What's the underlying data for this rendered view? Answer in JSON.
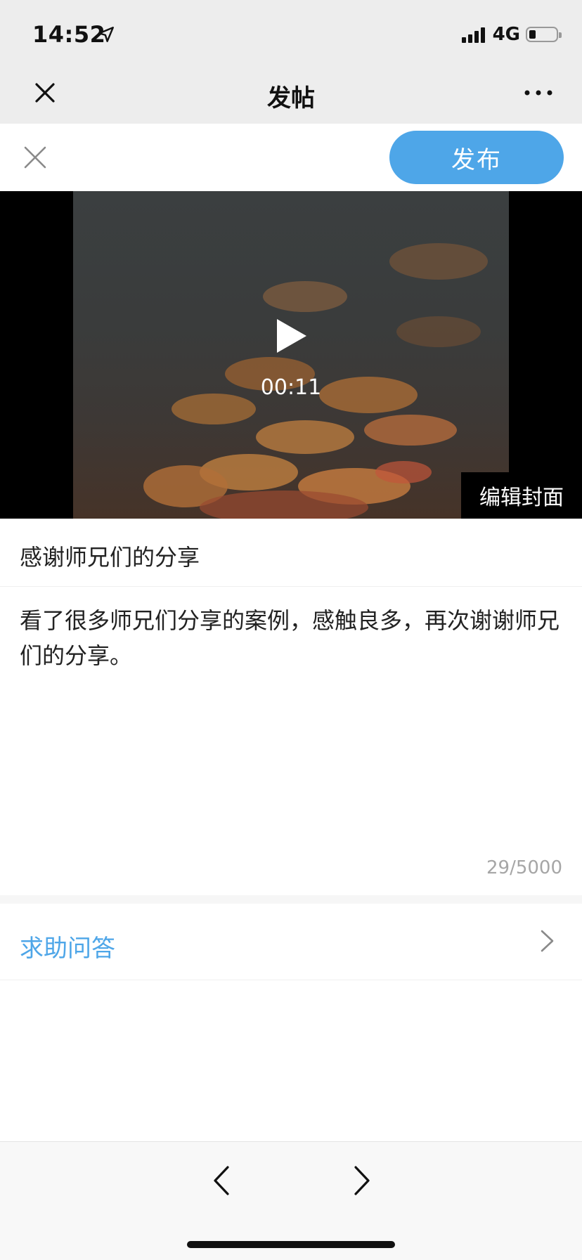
{
  "status_bar": {
    "time": "14:52",
    "network": "4G",
    "battery_level": 0.2,
    "location_icon": "location-arrow-icon"
  },
  "nav": {
    "title": "发帖",
    "close_icon": "close-icon",
    "more_icon": "more-icon"
  },
  "action_bar": {
    "close_icon": "close-icon",
    "publish_label": "发布"
  },
  "video": {
    "duration": "00:11",
    "edit_cover_label": "编辑封面",
    "play_icon": "play-icon"
  },
  "post": {
    "title": "感谢师兄们的分享",
    "body": "看了很多师兄们分享的案例，感触良多，再次谢谢师兄们的分享。",
    "counter": "29/5000"
  },
  "help_row": {
    "label": "求助问答",
    "chevron_icon": "chevron-right-icon"
  },
  "bottom_toolbar": {
    "back_icon": "chevron-left-icon",
    "forward_icon": "chevron-right-icon"
  },
  "colors": {
    "accent": "#4ea6e8",
    "bar_background": "#ededed",
    "counter_text": "#a6a6a6"
  }
}
